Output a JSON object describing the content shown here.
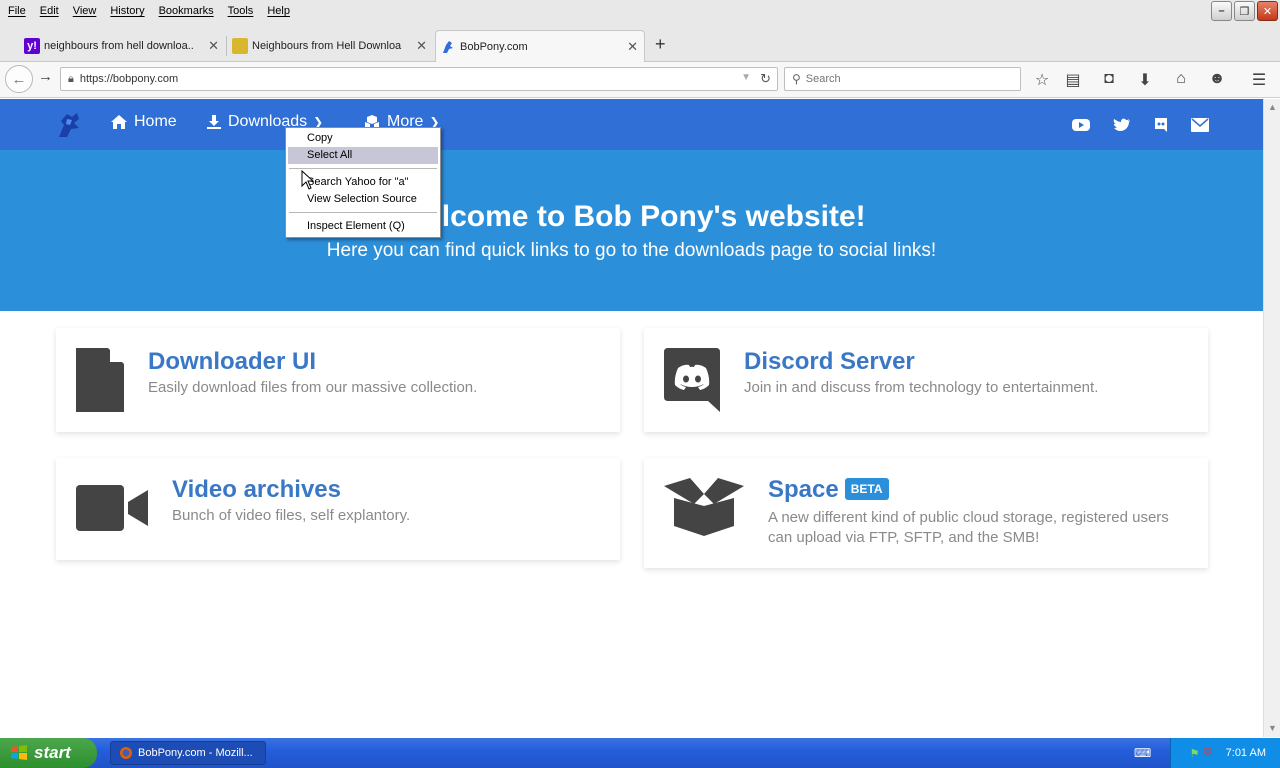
{
  "menubar": {
    "items": [
      "File",
      "Edit",
      "View",
      "History",
      "Bookmarks",
      "Tools",
      "Help"
    ]
  },
  "tabs": [
    {
      "title": "neighbours from hell downloa...",
      "active": false
    },
    {
      "title": "Neighbours from Hell Downloa...",
      "active": false
    },
    {
      "title": "BobPony.com",
      "active": true
    }
  ],
  "navbar": {
    "url": "https://bobpony.com",
    "search_placeholder": "Search"
  },
  "site_nav": {
    "home": "Home",
    "downloads": "Downloads",
    "more": "More"
  },
  "hero": {
    "title": "Welcome to Bob Pony's website!",
    "subtitle": "Here you can find quick links to go to the downloads page to social links!"
  },
  "cards": [
    {
      "title": "Downloader UI",
      "desc": "Easily download files from our massive collection."
    },
    {
      "title": "Discord Server",
      "desc": "Join in and discuss from technology to entertainment."
    },
    {
      "title": "Video archives",
      "desc": "Bunch of video files, self explantory."
    },
    {
      "title": "Space",
      "badge": "BETA",
      "desc": "A new different kind of public cloud storage, registered users can upload via FTP, SFTP, and the SMB!"
    }
  ],
  "context_menu": {
    "items": [
      "Copy",
      "Select All",
      "Search Yahoo for \"a\"",
      "View Selection Source",
      "Inspect Element (Q)"
    ],
    "highlighted": "Select All"
  },
  "taskbar": {
    "start": "start",
    "task": "BobPony.com - Mozill...",
    "clock": "7:01 AM"
  },
  "colors": {
    "site_nav_bg": "#2f6fd6",
    "hero_bg": "#2c8fd9",
    "card_title": "#3a78c6",
    "icon_dark": "#444444"
  }
}
